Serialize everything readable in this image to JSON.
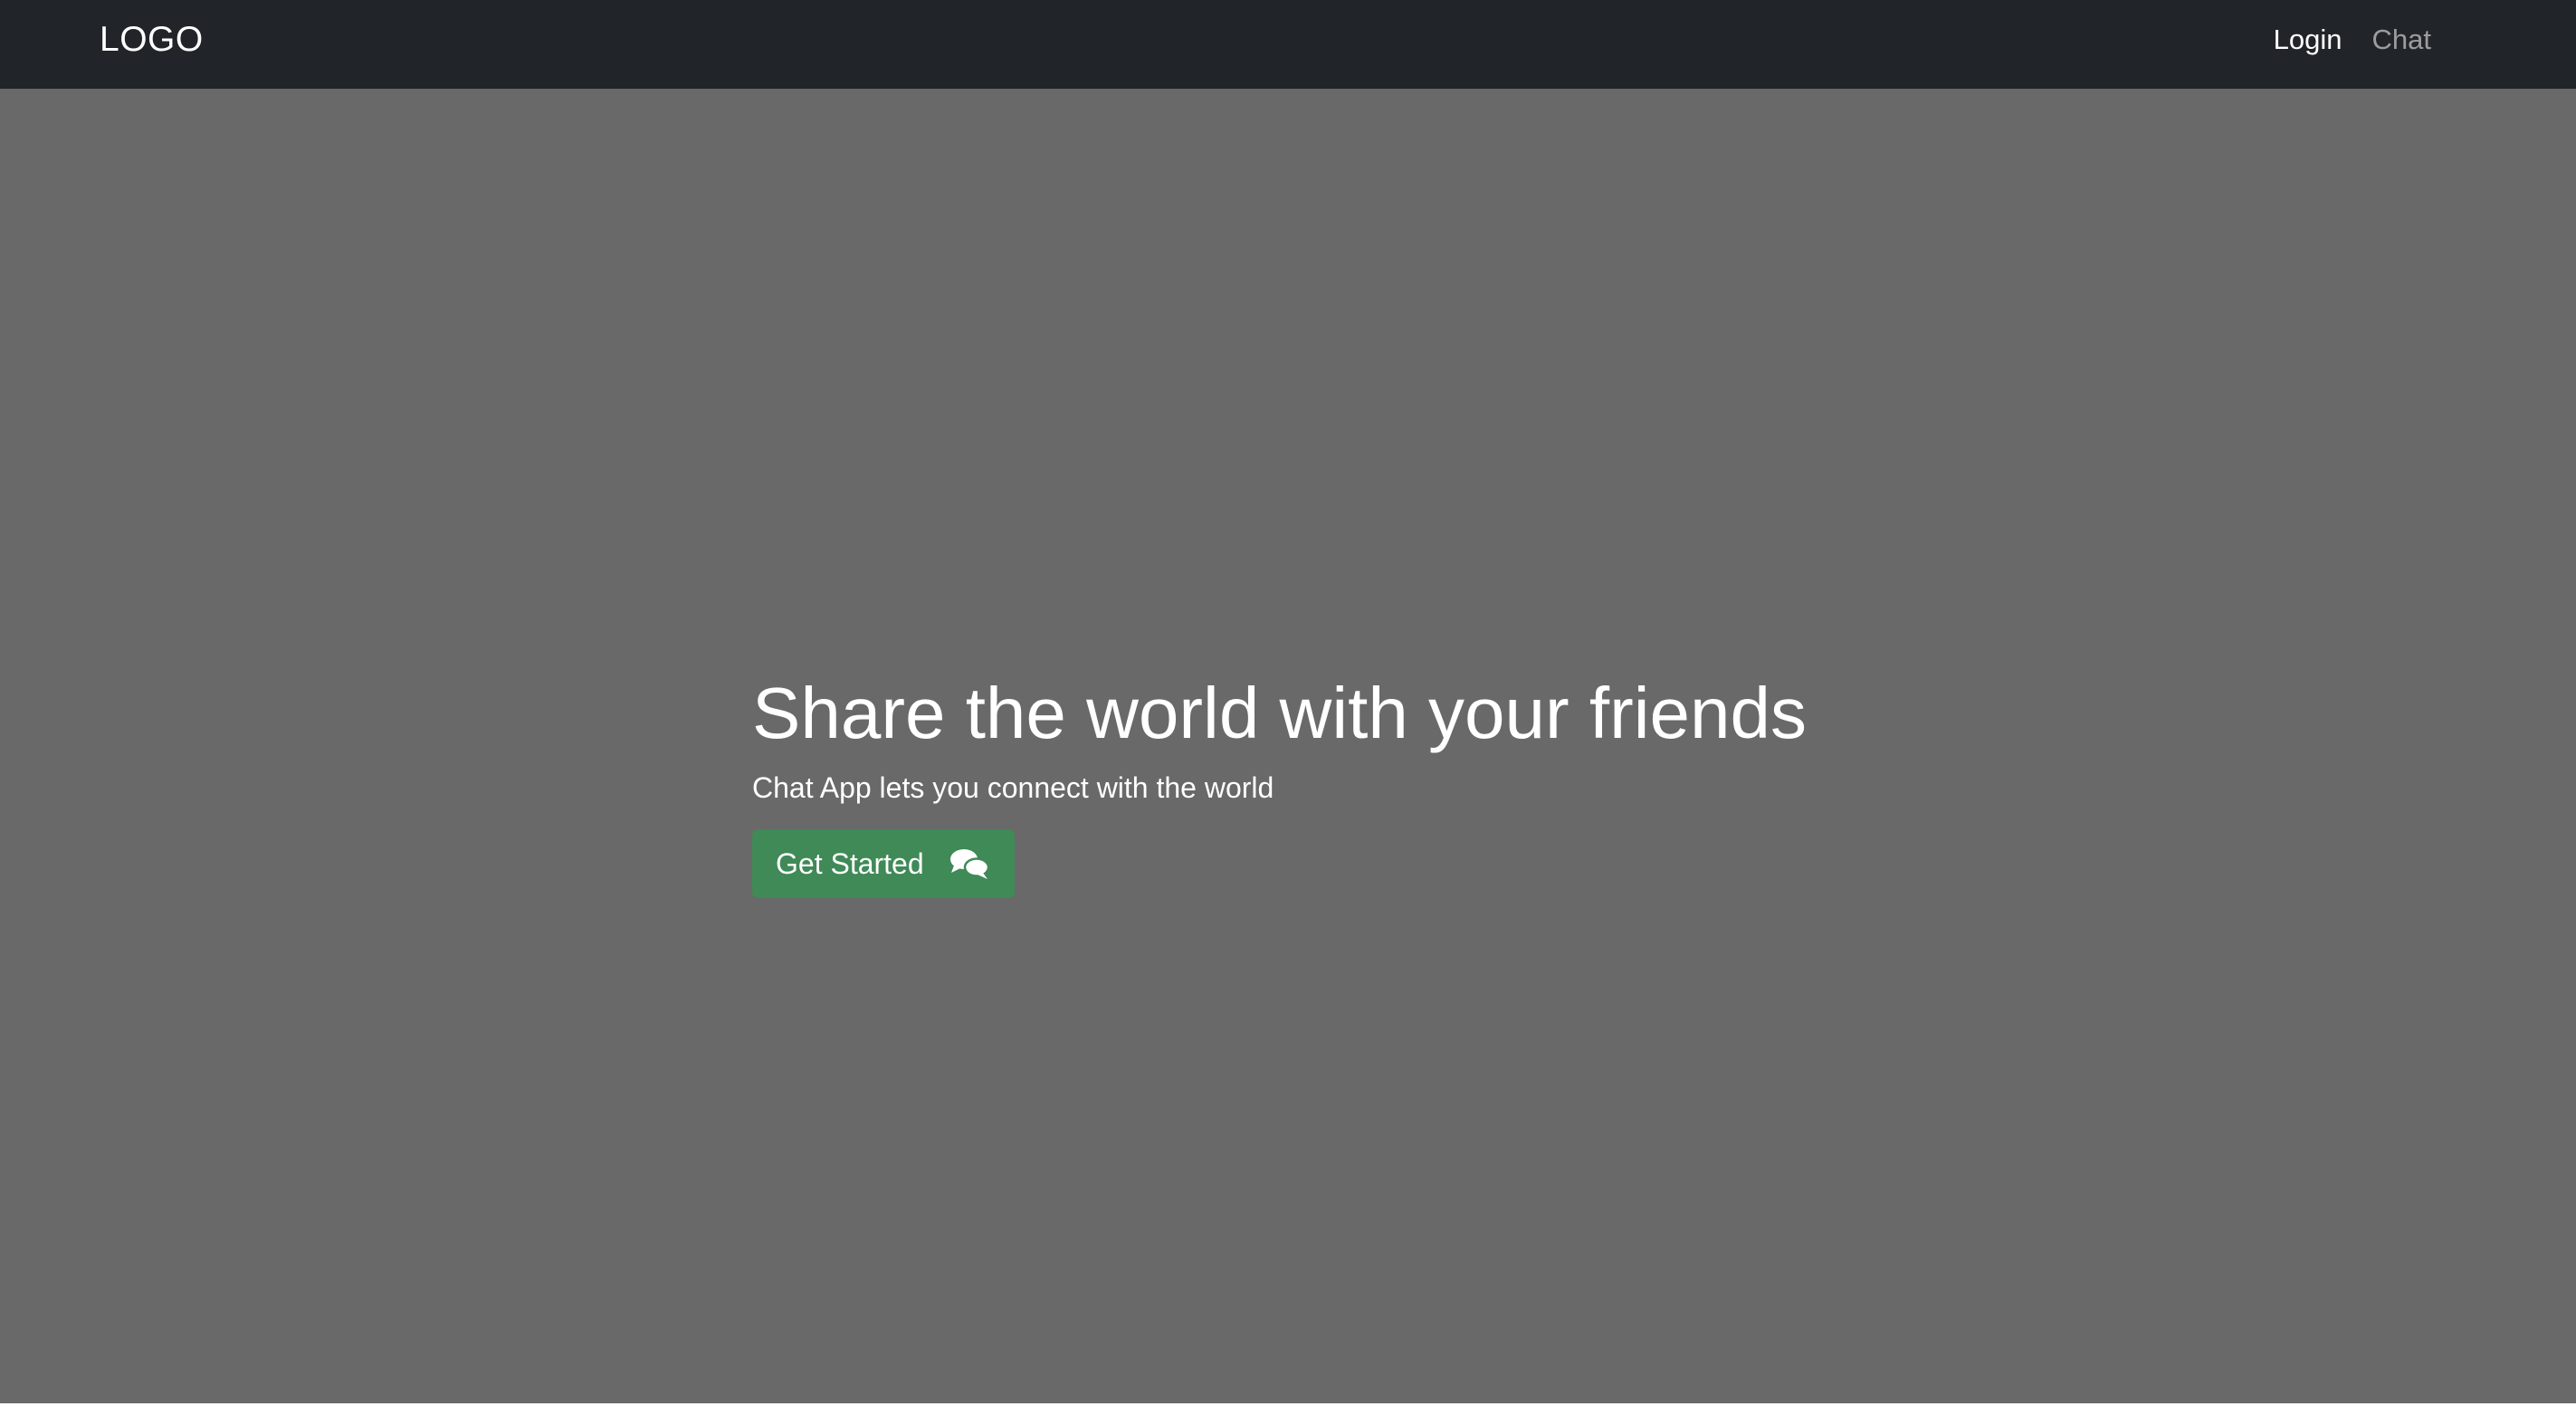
{
  "navbar": {
    "brand": "LOGO",
    "links": [
      {
        "label": "Login",
        "state": "active"
      },
      {
        "label": "Chat",
        "state": "inactive"
      }
    ],
    "background": "#212529"
  },
  "hero": {
    "title": "Share the world with your friends",
    "subtitle": "Chat App lets you connect with the world",
    "cta": {
      "label": "Get Started",
      "icon": "comments-icon",
      "color": "#3f8a57"
    },
    "background": "#696969"
  }
}
